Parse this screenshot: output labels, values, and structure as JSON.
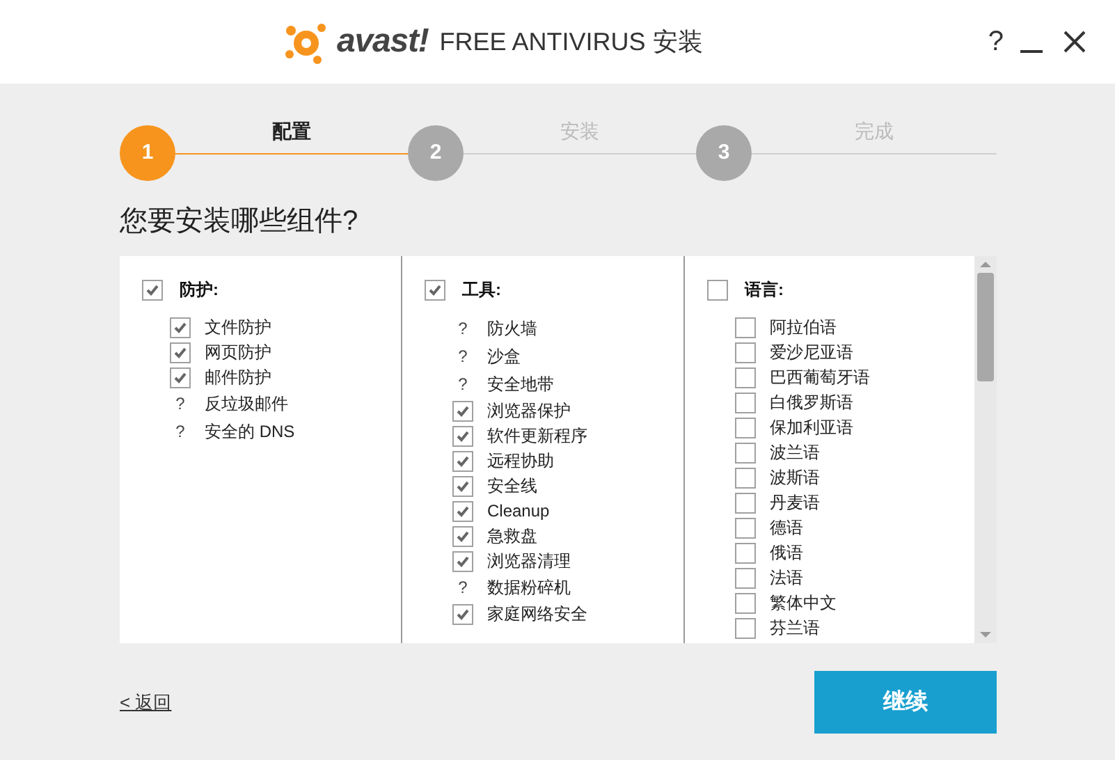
{
  "window": {
    "brand": "avast!",
    "title": "FREE ANTIVIRUS 安装",
    "controls": [
      {
        "kind": "help",
        "label": "?"
      },
      {
        "kind": "minimize"
      },
      {
        "kind": "close"
      }
    ]
  },
  "steps": [
    {
      "number": "1",
      "label": "配置",
      "selected": true
    },
    {
      "number": "2",
      "label": "安装",
      "selected": false
    },
    {
      "number": "3",
      "label": "完成",
      "selected": false
    }
  ],
  "heading": "您要安装哪些组件?",
  "groups": [
    {
      "title": "防护:",
      "checked": true,
      "items": [
        {
          "kind": "checkbox",
          "label": "文件防护",
          "checked": true
        },
        {
          "kind": "checkbox",
          "label": "网页防护",
          "checked": true
        },
        {
          "kind": "checkbox",
          "label": "邮件防护",
          "checked": true
        },
        {
          "kind": "info",
          "mark": "?",
          "label": "反垃圾邮件"
        },
        {
          "kind": "info",
          "mark": "?",
          "label": "安全的 DNS"
        }
      ]
    },
    {
      "title": "工具:",
      "checked": true,
      "items": [
        {
          "kind": "info",
          "mark": "?",
          "label": "防火墙"
        },
        {
          "kind": "info",
          "mark": "?",
          "label": "沙盒"
        },
        {
          "kind": "info",
          "mark": "?",
          "label": "安全地带"
        },
        {
          "kind": "checkbox",
          "label": "浏览器保护",
          "checked": true
        },
        {
          "kind": "checkbox",
          "label": "软件更新程序",
          "checked": true
        },
        {
          "kind": "checkbox",
          "label": "远程协助",
          "checked": true
        },
        {
          "kind": "checkbox",
          "label": "安全线",
          "checked": true
        },
        {
          "kind": "checkbox",
          "label": "Cleanup",
          "checked": true
        },
        {
          "kind": "checkbox",
          "label": "急救盘",
          "checked": true
        },
        {
          "kind": "checkbox",
          "label": "浏览器清理",
          "checked": true
        },
        {
          "kind": "info",
          "mark": "?",
          "label": "数据粉碎机"
        },
        {
          "kind": "checkbox",
          "label": "家庭网络安全",
          "checked": true
        }
      ]
    },
    {
      "title": "语言:",
      "checked": false,
      "items": [
        {
          "kind": "checkbox",
          "label": "阿拉伯语",
          "checked": false
        },
        {
          "kind": "checkbox",
          "label": "爱沙尼亚语",
          "checked": false
        },
        {
          "kind": "checkbox",
          "label": "巴西葡萄牙语",
          "checked": false
        },
        {
          "kind": "checkbox",
          "label": "白俄罗斯语",
          "checked": false
        },
        {
          "kind": "checkbox",
          "label": "保加利亚语",
          "checked": false
        },
        {
          "kind": "checkbox",
          "label": "波兰语",
          "checked": false
        },
        {
          "kind": "checkbox",
          "label": "波斯语",
          "checked": false
        },
        {
          "kind": "checkbox",
          "label": "丹麦语",
          "checked": false
        },
        {
          "kind": "checkbox",
          "label": "德语",
          "checked": false
        },
        {
          "kind": "checkbox",
          "label": "俄语",
          "checked": false
        },
        {
          "kind": "checkbox",
          "label": "法语",
          "checked": false
        },
        {
          "kind": "checkbox",
          "label": "繁体中文",
          "checked": false
        },
        {
          "kind": "checkbox",
          "label": "芬兰语",
          "checked": false
        }
      ]
    }
  ],
  "back_link": "< 返回",
  "continue_button": "继续"
}
